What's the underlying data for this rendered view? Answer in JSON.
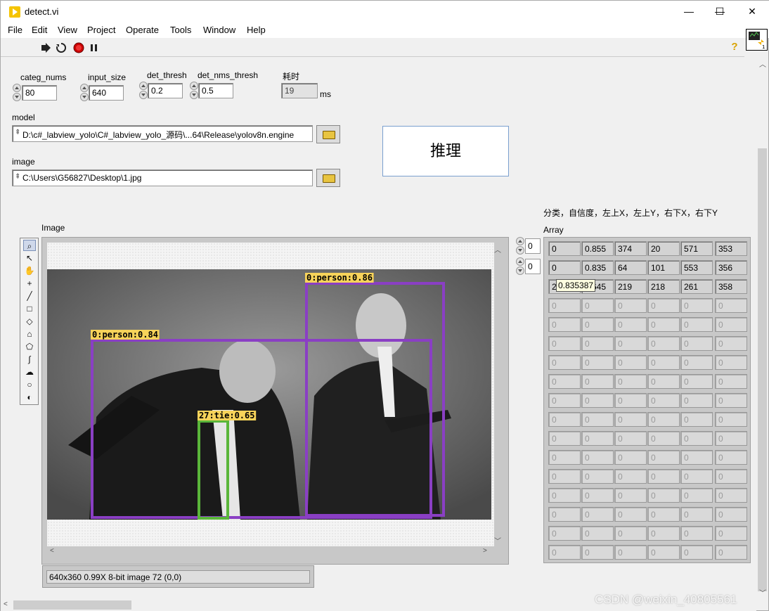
{
  "window": {
    "title": "detect.vi",
    "minimize": "—",
    "maximize": "☐",
    "close": "✕"
  },
  "menu": [
    "File",
    "Edit",
    "View",
    "Project",
    "Operate",
    "Tools",
    "Window",
    "Help"
  ],
  "controls": {
    "categ_nums": {
      "label": "categ_nums",
      "value": "80"
    },
    "input_size": {
      "label": "input_size",
      "value": "640"
    },
    "det_thresh": {
      "label": "det_thresh",
      "value": "0.2"
    },
    "det_nms_thresh": {
      "label": "det_nms_thresh",
      "value": "0.5"
    },
    "elapsed": {
      "label": "耗时",
      "value": "19",
      "unit": "ms"
    },
    "model": {
      "label": "model",
      "value": "D:\\c#_labview_yolo\\C#_labview_yolo_源码\\...64\\Release\\yolov8n.engine"
    },
    "image": {
      "label": "image",
      "value": "C:\\Users\\G56827\\Desktop\\1.jpg"
    },
    "run_button": "推理"
  },
  "display": {
    "label": "Image",
    "status": "640x360 0.99X 8-bit image 72     (0,0)",
    "detections": [
      {
        "text": "0:person:0.86",
        "color": "#8a3fc4"
      },
      {
        "text": "0:person:0.84",
        "color": "#8a3fc4"
      },
      {
        "text": "27:tie:0.65",
        "color": "#5ab63a"
      }
    ],
    "label_bg": "#f7d35a"
  },
  "array": {
    "header": "分类，自信度，左上X，左上Y，右下X，右下Y",
    "label": "Array",
    "index0": "0",
    "index1": "0",
    "rows": [
      [
        "0",
        "0.855",
        "374",
        "20",
        "571",
        "353"
      ],
      [
        "0",
        "0.835",
        "64",
        "101",
        "553",
        "356"
      ],
      [
        "27",
        "0.645",
        "219",
        "218",
        "261",
        "358"
      ]
    ],
    "empty_value": "0",
    "tooltip": "0.835387"
  },
  "watermark": "CSDN @weixin_40805561"
}
